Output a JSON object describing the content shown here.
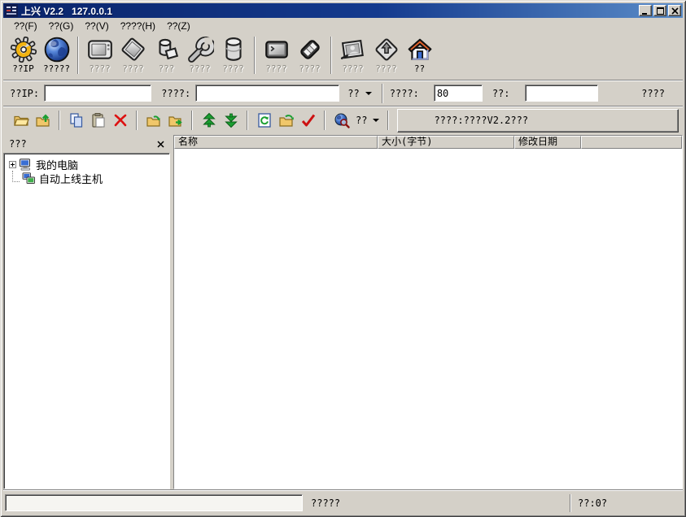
{
  "colors": {
    "chrome": "#d4d0c8",
    "titlebar_start": "#0a246a",
    "titlebar_end": "#5a8cc8",
    "disabled_text": "#8e8c84",
    "accent_yellow": "#f2b310",
    "accent_green": "#1a9e30",
    "accent_red": "#cc1111",
    "globe_blue": "#3a6ed4",
    "roof_orange": "#e8632a"
  },
  "window": {
    "title": "上兴 V2.2   127.0.0.1",
    "app_icon": "app-logo-icon",
    "controls": {
      "minimize": "minimize-icon",
      "maximize": "maximize-icon",
      "close": "close-icon"
    }
  },
  "menu": {
    "items": [
      {
        "label": "??(F)"
      },
      {
        "label": "??(G)"
      },
      {
        "label": "??(V)"
      },
      {
        "label": "????(H)"
      },
      {
        "label": "??(Z)"
      }
    ]
  },
  "toolbar_main": {
    "groups": [
      {
        "buttons": [
          {
            "icon": "gear-ip-icon",
            "label": "??IP",
            "enabled": true
          },
          {
            "icon": "globe-icon",
            "label": "?????",
            "enabled": true
          }
        ]
      },
      {
        "buttons": [
          {
            "icon": "monitor-icon",
            "label": "????",
            "enabled": false
          },
          {
            "icon": "floppy-tilted-icon",
            "label": "????",
            "enabled": false
          },
          {
            "icon": "cylinder-page-icon",
            "label": "???",
            "enabled": false
          },
          {
            "icon": "wrench-icon",
            "label": "????",
            "enabled": false
          },
          {
            "icon": "database-icon",
            "label": "????",
            "enabled": false
          }
        ]
      },
      {
        "buttons": [
          {
            "icon": "terminal-icon",
            "label": "????",
            "enabled": false
          },
          {
            "icon": "keyboard-tilted-icon",
            "label": "????",
            "enabled": false
          }
        ]
      },
      {
        "buttons": [
          {
            "icon": "photo-icon",
            "label": "????",
            "enabled": false
          },
          {
            "icon": "diamond-arrow-icon",
            "label": "????",
            "enabled": false
          },
          {
            "icon": "home-icon",
            "label": "??",
            "enabled": true
          }
        ]
      }
    ]
  },
  "connect_bar": {
    "ip_label": "??IP:",
    "ip_value": "",
    "domain_label": "????:",
    "domain_value": "",
    "mode_label": "??",
    "port_label": "????:",
    "port_value": "80",
    "pass_label": "??:",
    "pass_value": "",
    "connect_label": "????"
  },
  "file_toolbar": {
    "buttons": [
      "folder-open-icon",
      "folder-up-icon",
      "copy-icon",
      "paste-icon",
      "delete-icon",
      "folder-in-icon",
      "folder-out-icon",
      "upload-icon",
      "download-icon",
      "refresh-icon",
      "folder-go-icon",
      "confirm-check-icon",
      "web-search-icon"
    ],
    "search_label": "??",
    "message": "????:????V2.2???"
  },
  "sidebar": {
    "header_label": "???",
    "close_icon": "close-icon",
    "items": [
      {
        "icon": "my-computer-icon",
        "label": "我的电脑",
        "expander": "+"
      },
      {
        "icon": "online-hosts-icon",
        "label": "自动上线主机"
      }
    ]
  },
  "file_list": {
    "columns": [
      "名称",
      "大小(字节)",
      "修改日期",
      ""
    ]
  },
  "status_bar": {
    "progress_value": "",
    "message": "?????",
    "count": "??:0?"
  }
}
